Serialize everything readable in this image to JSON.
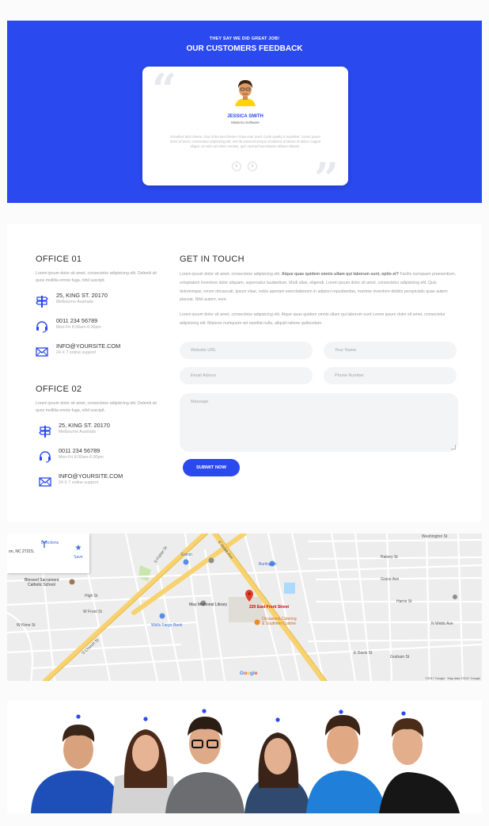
{
  "feedback": {
    "kicker": "THEY SAY WE DID GREAT JOB!",
    "title": "OUR CUSTOMERS FEEDBACK",
    "name": "JESSICA SMITH",
    "role": "Matorna Software",
    "text": "Excellent SEO theme. One of the best theme I have ever used. Code quality is excellent. Lorem ipsum dolor sit amet, consectetur adipisicing elit, sed do eiusmod tempor incididunt ut labore et dolore magna aliqua. Ut enim ad minim veniam, quis nostrud exercitation ullamco laboris.",
    "prev_icon": "chevron-left-icon",
    "next_icon": "chevron-right-icon",
    "accent": "#2a49ef"
  },
  "offices": [
    {
      "title": "OFFICE 01",
      "desc": "Lorem ipsum dolor sit amet, consectetur adipisicing elit. Deleniti sit quos mollitia omnis fuga, nihil suscipit.",
      "address": "25, KING ST. 20170",
      "address_sub": "Melbourne Australia",
      "phone": "0011 234 56789",
      "phone_sub": "Mon-Fri 8:30am-6:30pm",
      "email": "INFO@YOURSITE.COM",
      "email_sub": "24 X 7 online support"
    },
    {
      "title": "OFFICE 02",
      "desc": "Lorem ipsum dolor sit amet, consectetur adipisicing elit. Deleniti sit quos mollitia omnis fuga, nihil suscipit.",
      "address": "25, KING ST. 20170",
      "address_sub": "Melbourne Australia",
      "phone": "0011 234 56789",
      "phone_sub": "Mon-Fri 8:30am-6:30pm",
      "email": "INFO@YOURSITE.COM",
      "email_sub": "24 X 7 online support"
    }
  ],
  "contact": {
    "title": "GET IN TOUCH",
    "para1_start": "Lorem ipsum dolor sit amet, consectetur adipisicing elit. ",
    "para1_bold": "Atque quas quidem omnis ullam qui laborum sunt, optio et?",
    "para1_end": " Facilis numquam praesentium, voluptatem inventore dolor aliquam, aspernatur laudantium. Modi alias, eligendi. Lorem ipsum dolor sit amet, consectetur adipisicing elit. Quis doloremque, rerum obcaecati. Ipsum vitae, nobis aperiam exercitationem in adipisci repudiandae, maxime inventore debitis perspiciatis quae autem placeat. Nihil autem, eum.",
    "para2": "Lorem ipsum dolor sit amet, consectetur adipisicing elit. Atque quas quidem omnis ullam qui laborum sunt Lorem ipsum dolor sit amet, consectetur adipisicing elit. Maiores numquam vel repellat nulla, aliquid ratione quibusdam.",
    "website_placeholder": "Website URL",
    "name_placeholder": "Your Name",
    "email_placeholder": "Email Adress",
    "phone_placeholder": "Phone Number",
    "message_placeholder": "Massage",
    "submit_label": "SUBMIT NOW"
  },
  "map": {
    "address": "on, NC 27215,",
    "directions_label": "Directions",
    "save_label": "Save",
    "marker_label": "220 East Front Street",
    "labels": {
      "blessed": "Blessed Sacrament",
      "catholic": "Catholic School",
      "high": "High St",
      "exxon": "Exxon",
      "burlington": "Burlington",
      "may_memorial": "May Memorial Library",
      "wells_fargo": "Wells Fargo Bank",
      "occasions1": "Occasions Catering",
      "occasions2": "& Southern Cuisine",
      "washington": "Washington St",
      "rainey": "Rainey St",
      "grace": "Grace Ave",
      "harris": "Harris St",
      "n_webb": "N Webb Ave",
      "e_webb": "E Webb Ave",
      "s_church": "S Church St",
      "w_front": "W Front St",
      "w_kime": "W Kime St",
      "e_davis": "E Davis St",
      "graham": "Graham St",
      "s_fisher": "S Fisher St"
    },
    "google": "Google",
    "copyright": "©2017 Google · Map data ©2017 Google"
  },
  "team": {
    "accent": "#2a49ef"
  }
}
